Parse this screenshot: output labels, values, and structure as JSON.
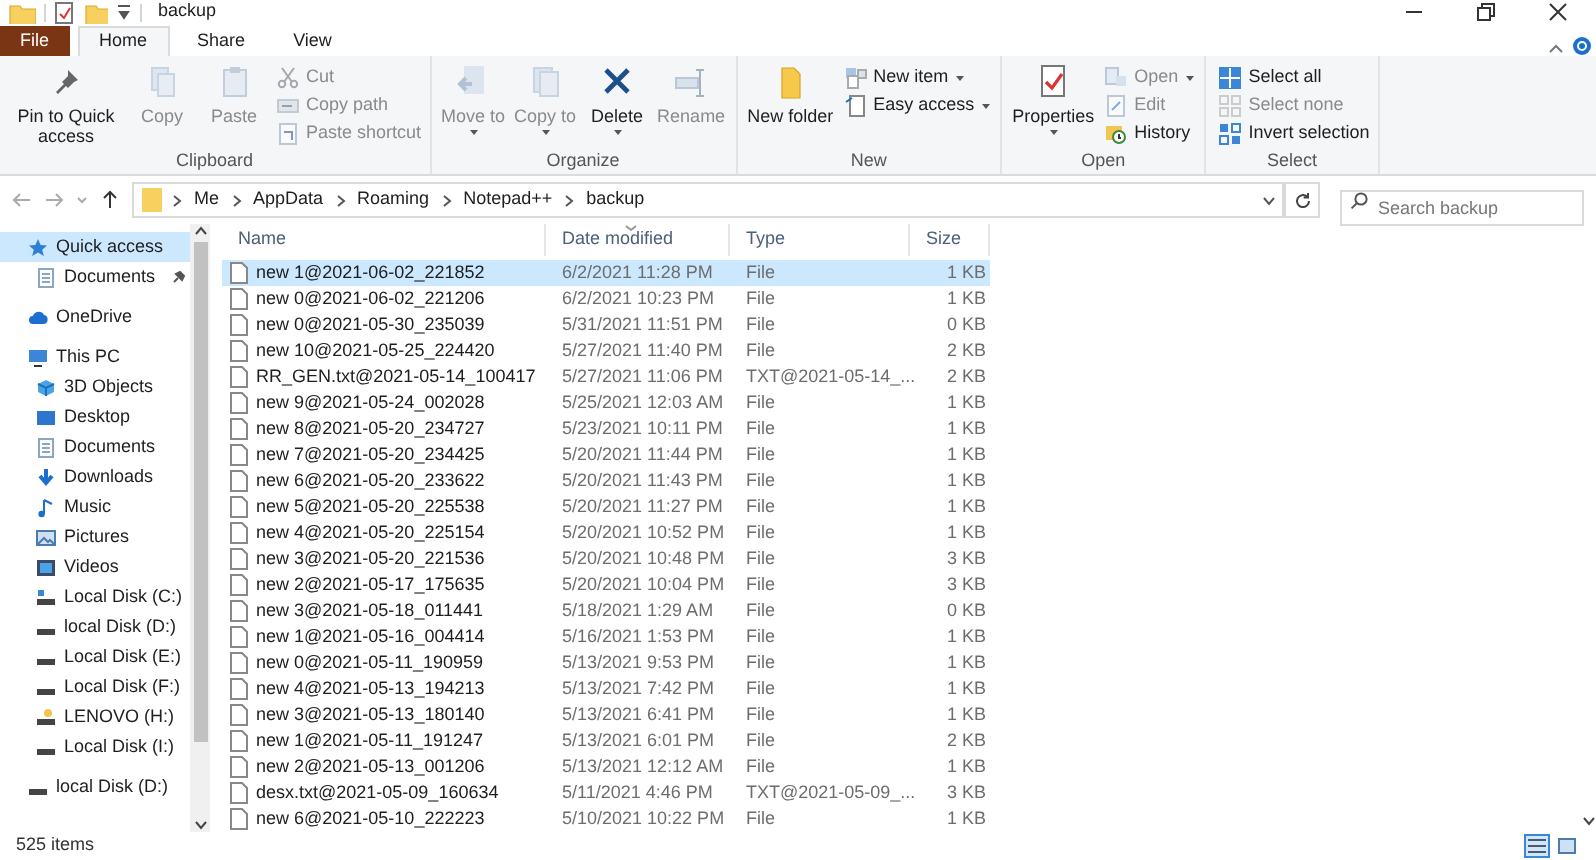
{
  "window": {
    "title": "backup"
  },
  "tabs": [
    {
      "label": "File",
      "kind": "file",
      "selected": false
    },
    {
      "label": "Home",
      "kind": "tab",
      "selected": true
    },
    {
      "label": "Share",
      "kind": "tab",
      "selected": false
    },
    {
      "label": "View",
      "kind": "tab",
      "selected": false
    }
  ],
  "ribbon": {
    "groups": [
      {
        "label": "Clipboard",
        "items": [
          {
            "label": "Pin to Quick access",
            "kind": "large",
            "disabled": false,
            "dropdown": false
          },
          {
            "label": "Copy",
            "kind": "large",
            "disabled": true,
            "dropdown": false
          },
          {
            "label": "Paste",
            "kind": "large",
            "disabled": true,
            "dropdown": false
          },
          {
            "label": "Cut",
            "kind": "small",
            "disabled": true,
            "dropdown": false
          },
          {
            "label": "Copy path",
            "kind": "small",
            "disabled": true,
            "dropdown": false
          },
          {
            "label": "Paste shortcut",
            "kind": "small",
            "disabled": true,
            "dropdown": false
          }
        ]
      },
      {
        "label": "Organize",
        "items": [
          {
            "label": "Move to",
            "kind": "large",
            "disabled": true,
            "dropdown": true
          },
          {
            "label": "Copy to",
            "kind": "large",
            "disabled": true,
            "dropdown": true
          },
          {
            "label": "Delete",
            "kind": "large",
            "disabled": false,
            "dropdown": true
          },
          {
            "label": "Rename",
            "kind": "large",
            "disabled": true,
            "dropdown": false
          }
        ]
      },
      {
        "label": "New",
        "items": [
          {
            "label": "New folder",
            "kind": "large",
            "disabled": false,
            "dropdown": false
          },
          {
            "label": "New item",
            "kind": "small",
            "disabled": false,
            "dropdown": true
          },
          {
            "label": "Easy access",
            "kind": "small",
            "disabled": false,
            "dropdown": true
          }
        ]
      },
      {
        "label": "Open",
        "items": [
          {
            "label": "Properties",
            "kind": "large",
            "disabled": false,
            "dropdown": true
          },
          {
            "label": "Open",
            "kind": "small",
            "disabled": true,
            "dropdown": true
          },
          {
            "label": "Edit",
            "kind": "small",
            "disabled": true,
            "dropdown": false
          },
          {
            "label": "History",
            "kind": "small",
            "disabled": false,
            "dropdown": false
          }
        ]
      },
      {
        "label": "Select",
        "items": [
          {
            "label": "Select all",
            "kind": "small",
            "disabled": false,
            "dropdown": false
          },
          {
            "label": "Select none",
            "kind": "small",
            "disabled": true,
            "dropdown": false
          },
          {
            "label": "Invert selection",
            "kind": "small",
            "disabled": false,
            "dropdown": false
          }
        ]
      }
    ]
  },
  "address": {
    "path": [
      "Me",
      "AppData",
      "Roaming",
      "Notepad++",
      "backup"
    ],
    "search": {
      "placeholder": "Search backup"
    }
  },
  "navigation": [
    {
      "label": "Quick access",
      "selected": true,
      "children": [
        {
          "label": "Documents",
          "selected": false
        }
      ]
    },
    {
      "label": "OneDrive",
      "selected": false
    },
    {
      "label": "This PC",
      "selected": false,
      "children": [
        {
          "label": "3D Objects",
          "selected": false
        },
        {
          "label": "Desktop",
          "selected": false
        },
        {
          "label": "Documents",
          "selected": false
        },
        {
          "label": "Downloads",
          "selected": false
        },
        {
          "label": "Music",
          "selected": false
        },
        {
          "label": "Pictures",
          "selected": false
        },
        {
          "label": "Videos",
          "selected": false
        },
        {
          "label": "Local Disk (C:)",
          "selected": false
        },
        {
          "label": "local Disk (D:)",
          "selected": false
        },
        {
          "label": "Local Disk (E:)",
          "selected": false
        },
        {
          "label": "Local Disk (F:)",
          "selected": false
        },
        {
          "label": "LENOVO (H:)",
          "selected": false
        },
        {
          "label": "Local Disk (I:)",
          "selected": false
        }
      ]
    },
    {
      "label": "local Disk (D:)",
      "selected": false
    }
  ],
  "table": {
    "columns": [
      "Name",
      "Date modified",
      "Type",
      "Size"
    ],
    "rows": [
      {
        "name": "new 1@2021-06-02_221852",
        "date": "6/2/2021 11:28 PM",
        "type": "File",
        "size": "1 KB",
        "selected": true
      },
      {
        "name": "new 0@2021-06-02_221206",
        "date": "6/2/2021 10:23 PM",
        "type": "File",
        "size": "1 KB",
        "selected": false
      },
      {
        "name": "new 0@2021-05-30_235039",
        "date": "5/31/2021 11:51 PM",
        "type": "File",
        "size": "0 KB",
        "selected": false
      },
      {
        "name": "new 10@2021-05-25_224420",
        "date": "5/27/2021 11:40 PM",
        "type": "File",
        "size": "2 KB",
        "selected": false
      },
      {
        "name": "RR_GEN.txt@2021-05-14_100417",
        "date": "5/27/2021 11:06 PM",
        "type": "TXT@2021-05-14_...",
        "size": "2 KB",
        "selected": false
      },
      {
        "name": "new 9@2021-05-24_002028",
        "date": "5/25/2021 12:03 AM",
        "type": "File",
        "size": "1 KB",
        "selected": false
      },
      {
        "name": "new 8@2021-05-20_234727",
        "date": "5/23/2021 10:11 PM",
        "type": "File",
        "size": "1 KB",
        "selected": false
      },
      {
        "name": "new 7@2021-05-20_234425",
        "date": "5/20/2021 11:44 PM",
        "type": "File",
        "size": "1 KB",
        "selected": false
      },
      {
        "name": "new 6@2021-05-20_233622",
        "date": "5/20/2021 11:43 PM",
        "type": "File",
        "size": "1 KB",
        "selected": false
      },
      {
        "name": "new 5@2021-05-20_225538",
        "date": "5/20/2021 11:27 PM",
        "type": "File",
        "size": "1 KB",
        "selected": false
      },
      {
        "name": "new 4@2021-05-20_225154",
        "date": "5/20/2021 10:52 PM",
        "type": "File",
        "size": "1 KB",
        "selected": false
      },
      {
        "name": "new 3@2021-05-20_221536",
        "date": "5/20/2021 10:48 PM",
        "type": "File",
        "size": "3 KB",
        "selected": false
      },
      {
        "name": "new 2@2021-05-17_175635",
        "date": "5/20/2021 10:04 PM",
        "type": "File",
        "size": "3 KB",
        "selected": false
      },
      {
        "name": "new 3@2021-05-18_011441",
        "date": "5/18/2021 1:29 AM",
        "type": "File",
        "size": "0 KB",
        "selected": false
      },
      {
        "name": "new 1@2021-05-16_004414",
        "date": "5/16/2021 1:53 PM",
        "type": "File",
        "size": "1 KB",
        "selected": false
      },
      {
        "name": "new 0@2021-05-11_190959",
        "date": "5/13/2021 9:53 PM",
        "type": "File",
        "size": "1 KB",
        "selected": false
      },
      {
        "name": "new 4@2021-05-13_194213",
        "date": "5/13/2021 7:42 PM",
        "type": "File",
        "size": "1 KB",
        "selected": false
      },
      {
        "name": "new 3@2021-05-13_180140",
        "date": "5/13/2021 6:41 PM",
        "type": "File",
        "size": "1 KB",
        "selected": false
      },
      {
        "name": "new 1@2021-05-11_191247",
        "date": "5/13/2021 6:01 PM",
        "type": "File",
        "size": "2 KB",
        "selected": false
      },
      {
        "name": "new 2@2021-05-13_001206",
        "date": "5/13/2021 12:12 AM",
        "type": "File",
        "size": "1 KB",
        "selected": false
      },
      {
        "name": "desx.txt@2021-05-09_160634",
        "date": "5/11/2021 4:46 PM",
        "type": "TXT@2021-05-09_...",
        "size": "3 KB",
        "selected": false
      },
      {
        "name": "new 6@2021-05-10_222223",
        "date": "5/10/2021 10:22 PM",
        "type": "File",
        "size": "1 KB",
        "selected": false
      }
    ]
  },
  "status_bar": {
    "item_count": "525 items"
  }
}
